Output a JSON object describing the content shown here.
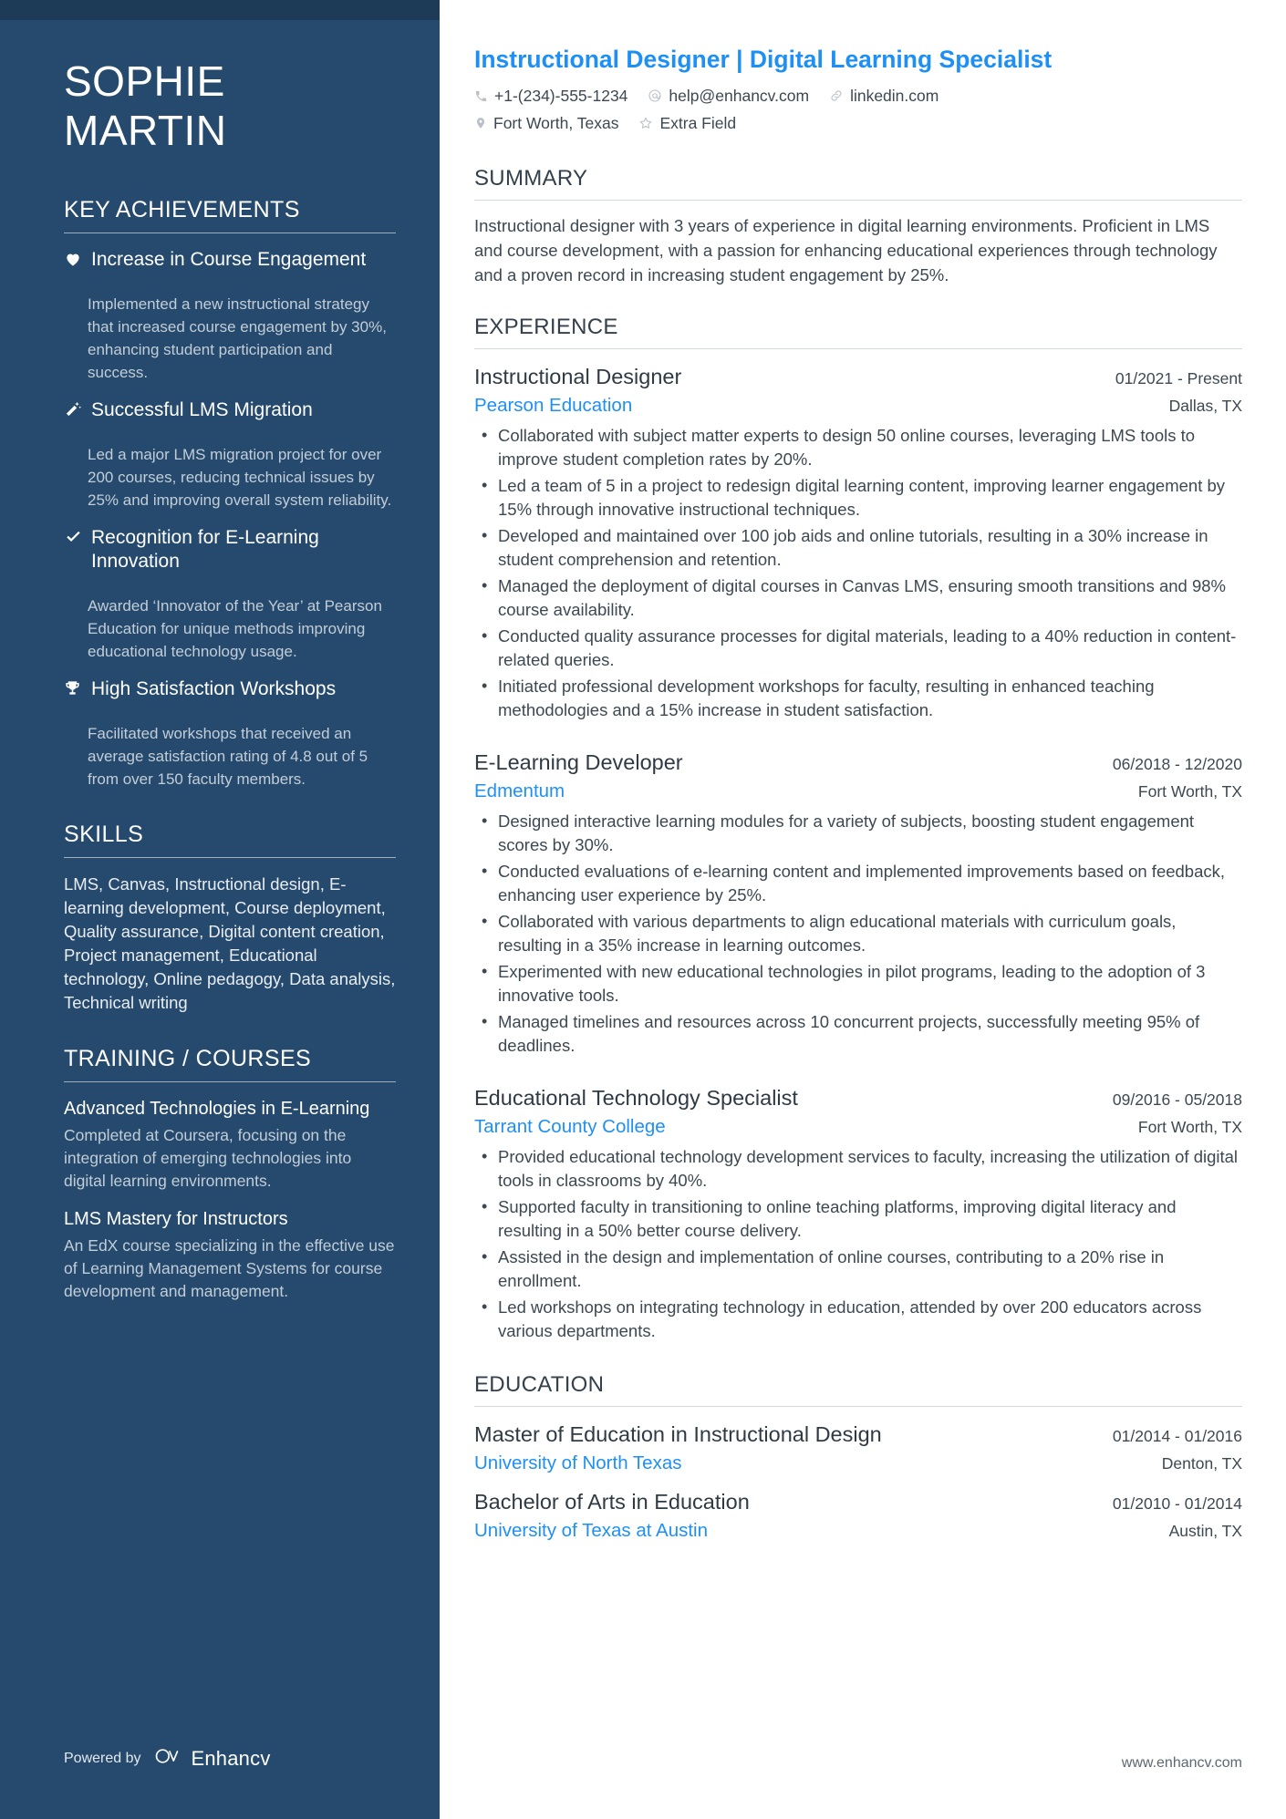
{
  "sidebar": {
    "name_first": "SOPHIE",
    "name_last": "MARTIN",
    "achievements_heading": "KEY ACHIEVEMENTS",
    "achievements": [
      {
        "icon": "heart-icon",
        "title": "Increase in Course Engagement",
        "desc": "Implemented a new instructional strategy that increased course engagement by 30%, enhancing student participation and success."
      },
      {
        "icon": "magic-wand-icon",
        "title": "Successful LMS Migration",
        "desc": "Led a major LMS migration project for over 200 courses, reducing technical issues by 25% and improving overall system reliability."
      },
      {
        "icon": "check-icon",
        "title": "Recognition for E-Learning Innovation",
        "desc": "Awarded ‘Innovator of the Year’ at Pearson Education for unique methods improving educational technology usage."
      },
      {
        "icon": "trophy-icon",
        "title": "High Satisfaction Workshops",
        "desc": "Facilitated workshops that received an average satisfaction rating of 4.8 out of 5 from over 150 faculty members."
      }
    ],
    "skills_heading": "SKILLS",
    "skills_text": "LMS, Canvas, Instructional design, E-learning development, Course deployment, Quality assurance, Digital content creation, Project management, Educational technology, Online pedagogy, Data analysis, Technical writing",
    "training_heading": "TRAINING / COURSES",
    "training": [
      {
        "title": "Advanced Technologies in E-Learning",
        "desc": "Completed at Coursera, focusing on the integration of emerging technologies into digital learning environments."
      },
      {
        "title": "LMS Mastery for Instructors",
        "desc": "An EdX course specializing in the effective use of Learning Management Systems for course development and management."
      }
    ],
    "powered_by_label": "Powered by",
    "brand_name": "Enhancv"
  },
  "header": {
    "title": "Instructional Designer | Digital Learning Specialist",
    "contacts_row1": [
      {
        "icon": "phone-icon",
        "text": "+1-(234)-555-1234"
      },
      {
        "icon": "email-icon",
        "text": "help@enhancv.com"
      },
      {
        "icon": "link-icon",
        "text": "linkedin.com"
      }
    ],
    "contacts_row2": [
      {
        "icon": "location-pin-icon",
        "text": "Fort Worth, Texas"
      },
      {
        "icon": "star-icon",
        "text": "Extra Field"
      }
    ]
  },
  "summary": {
    "heading": "SUMMARY",
    "text": "Instructional designer with 3 years of experience in digital learning environments. Proficient in LMS and course development, with a passion for enhancing educational experiences through technology and a proven record in increasing student engagement by 25%."
  },
  "experience": {
    "heading": "EXPERIENCE",
    "entries": [
      {
        "role": "Instructional Designer",
        "date": "01/2021 - Present",
        "company": "Pearson Education",
        "location": "Dallas, TX",
        "bullets": [
          "Collaborated with subject matter experts to design 50 online courses, leveraging LMS tools to improve student completion rates by 20%.",
          "Led a team of 5 in a project to redesign digital learning content, improving learner engagement by 15% through innovative instructional techniques.",
          "Developed and maintained over 100 job aids and online tutorials, resulting in a 30% increase in student comprehension and retention.",
          "Managed the deployment of digital courses in Canvas LMS, ensuring smooth transitions and 98% course availability.",
          "Conducted quality assurance processes for digital materials, leading to a 40% reduction in content-related queries.",
          "Initiated professional development workshops for faculty, resulting in enhanced teaching methodologies and a 15% increase in student satisfaction."
        ]
      },
      {
        "role": "E-Learning Developer",
        "date": "06/2018 - 12/2020",
        "company": "Edmentum",
        "location": "Fort Worth, TX",
        "bullets": [
          "Designed interactive learning modules for a variety of subjects, boosting student engagement scores by 30%.",
          "Conducted evaluations of e-learning content and implemented improvements based on feedback, enhancing user experience by 25%.",
          "Collaborated with various departments to align educational materials with curriculum goals, resulting in a 35% increase in learning outcomes.",
          "Experimented with new educational technologies in pilot programs, leading to the adoption of 3 innovative tools.",
          "Managed timelines and resources across 10 concurrent projects, successfully meeting 95% of deadlines."
        ]
      },
      {
        "role": "Educational Technology Specialist",
        "date": "09/2016 - 05/2018",
        "company": "Tarrant County College",
        "location": "Fort Worth, TX",
        "bullets": [
          "Provided educational technology development services to faculty, increasing the utilization of digital tools in classrooms by 40%.",
          "Supported faculty in transitioning to online teaching platforms, improving digital literacy and resulting in a 50% better course delivery.",
          "Assisted in the design and implementation of online courses, contributing to a 20% rise in enrollment.",
          "Led workshops on integrating technology in education, attended by over 200 educators across various departments."
        ]
      }
    ]
  },
  "education": {
    "heading": "EDUCATION",
    "entries": [
      {
        "degree": "Master of Education in Instructional Design",
        "date": "01/2014 - 01/2016",
        "school": "University of North Texas",
        "location": "Denton, TX"
      },
      {
        "degree": "Bachelor of Arts in Education",
        "date": "01/2010 - 01/2014",
        "school": "University of Texas at Austin",
        "location": "Austin, TX"
      }
    ]
  },
  "footer": {
    "url": "www.enhancv.com"
  },
  "colors": {
    "sidebar_bg": "#254a6d",
    "sidebar_topbar": "#1d3a57",
    "accent_blue": "#1e90f5",
    "heading_dark": "#34404c",
    "body_text": "#3d4852"
  }
}
